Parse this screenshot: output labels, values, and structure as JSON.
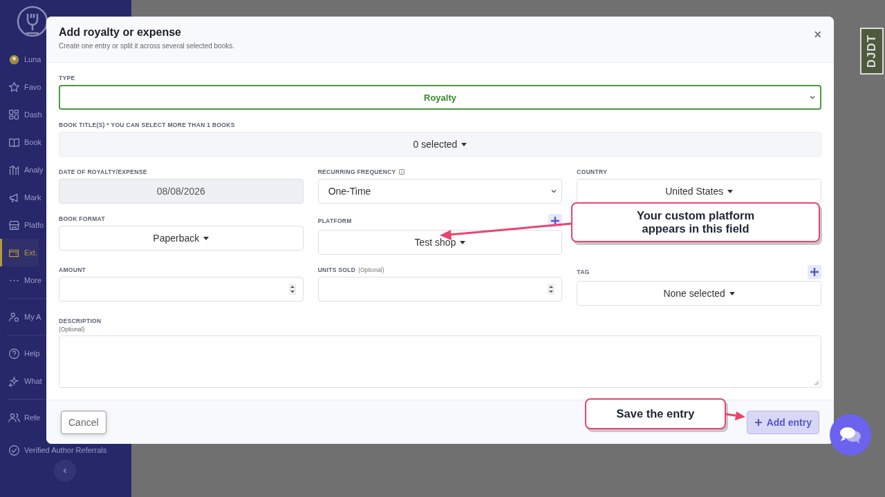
{
  "sidebar": {
    "items": [
      {
        "label": "Luna",
        "kind": "avatar",
        "selected": false,
        "divider_after": false
      },
      {
        "label": "Favo",
        "kind": "star",
        "selected": false,
        "divider_after": false
      },
      {
        "label": "Dash",
        "kind": "grid",
        "selected": false,
        "divider_after": false
      },
      {
        "label": "Book",
        "kind": "book",
        "selected": false,
        "divider_after": false
      },
      {
        "label": "Analy",
        "kind": "chart",
        "selected": false,
        "divider_after": false
      },
      {
        "label": "Mark",
        "kind": "megaphone",
        "selected": false,
        "divider_after": false
      },
      {
        "label": "Platfo",
        "kind": "store",
        "selected": false,
        "divider_after": false
      },
      {
        "label": "Ext.",
        "kind": "wallet",
        "selected": true,
        "divider_after": false
      },
      {
        "label": "More",
        "kind": "dots",
        "selected": false,
        "divider_after": true
      },
      {
        "label": "My A",
        "kind": "user",
        "selected": false,
        "divider_after": true
      },
      {
        "label": "Help",
        "kind": "help",
        "selected": false,
        "divider_after": false
      },
      {
        "label": "What",
        "kind": "sparkle",
        "selected": false,
        "divider_after": true
      },
      {
        "label": "Refe",
        "kind": "people",
        "selected": false,
        "divider_after": false
      },
      {
        "label": "Verified Author Referrals",
        "kind": "check",
        "selected": false,
        "divider_after": false
      }
    ]
  },
  "debug_tab": {
    "label": "DJDT"
  },
  "modal": {
    "title": "Add royalty or expense",
    "subtitle": "Create one entry or split it across several selected books.",
    "close": "×",
    "rows": [
      [
        {
          "kind": "select",
          "label": "TYPE",
          "value": "Royalty",
          "valid": true
        }
      ],
      [
        {
          "kind": "multi",
          "label": "BOOK TITLE(S) * YOU CAN SELECT MORE THAN 1 BOOKS",
          "value": "0 selected"
        }
      ],
      [
        {
          "kind": "date",
          "label": "DATE OF ROYALTY/EXPENSE",
          "value": "08/08/2026"
        },
        {
          "kind": "select",
          "label": "RECURRING FREQUENCY",
          "value": "One-Time",
          "valid": false,
          "info": true
        },
        {
          "kind": "dropdown",
          "label": "COUNTRY",
          "value": "United States"
        }
      ],
      [
        {
          "kind": "dropdown",
          "label": "BOOK FORMAT",
          "value": "Paperback"
        },
        {
          "kind": "dropdown",
          "label": "PLATFORM",
          "value": "Test shop",
          "add": true
        }
      ],
      [
        {
          "kind": "number",
          "label": "AMOUNT"
        },
        {
          "kind": "number",
          "label": "UNITS SOLD",
          "hint": "(Optional)"
        },
        {
          "kind": "dropdown",
          "label": "TAG",
          "value": "None selected",
          "add": true
        }
      ],
      [
        {
          "kind": "textarea",
          "label": "DESCRIPTION",
          "hint": "(Optional)"
        }
      ]
    ],
    "cancel": "Cancel",
    "submit": "Add entry"
  },
  "callouts": [
    {
      "text": "Your custom platform appears in this field"
    },
    {
      "text": "Save the entry"
    }
  ]
}
